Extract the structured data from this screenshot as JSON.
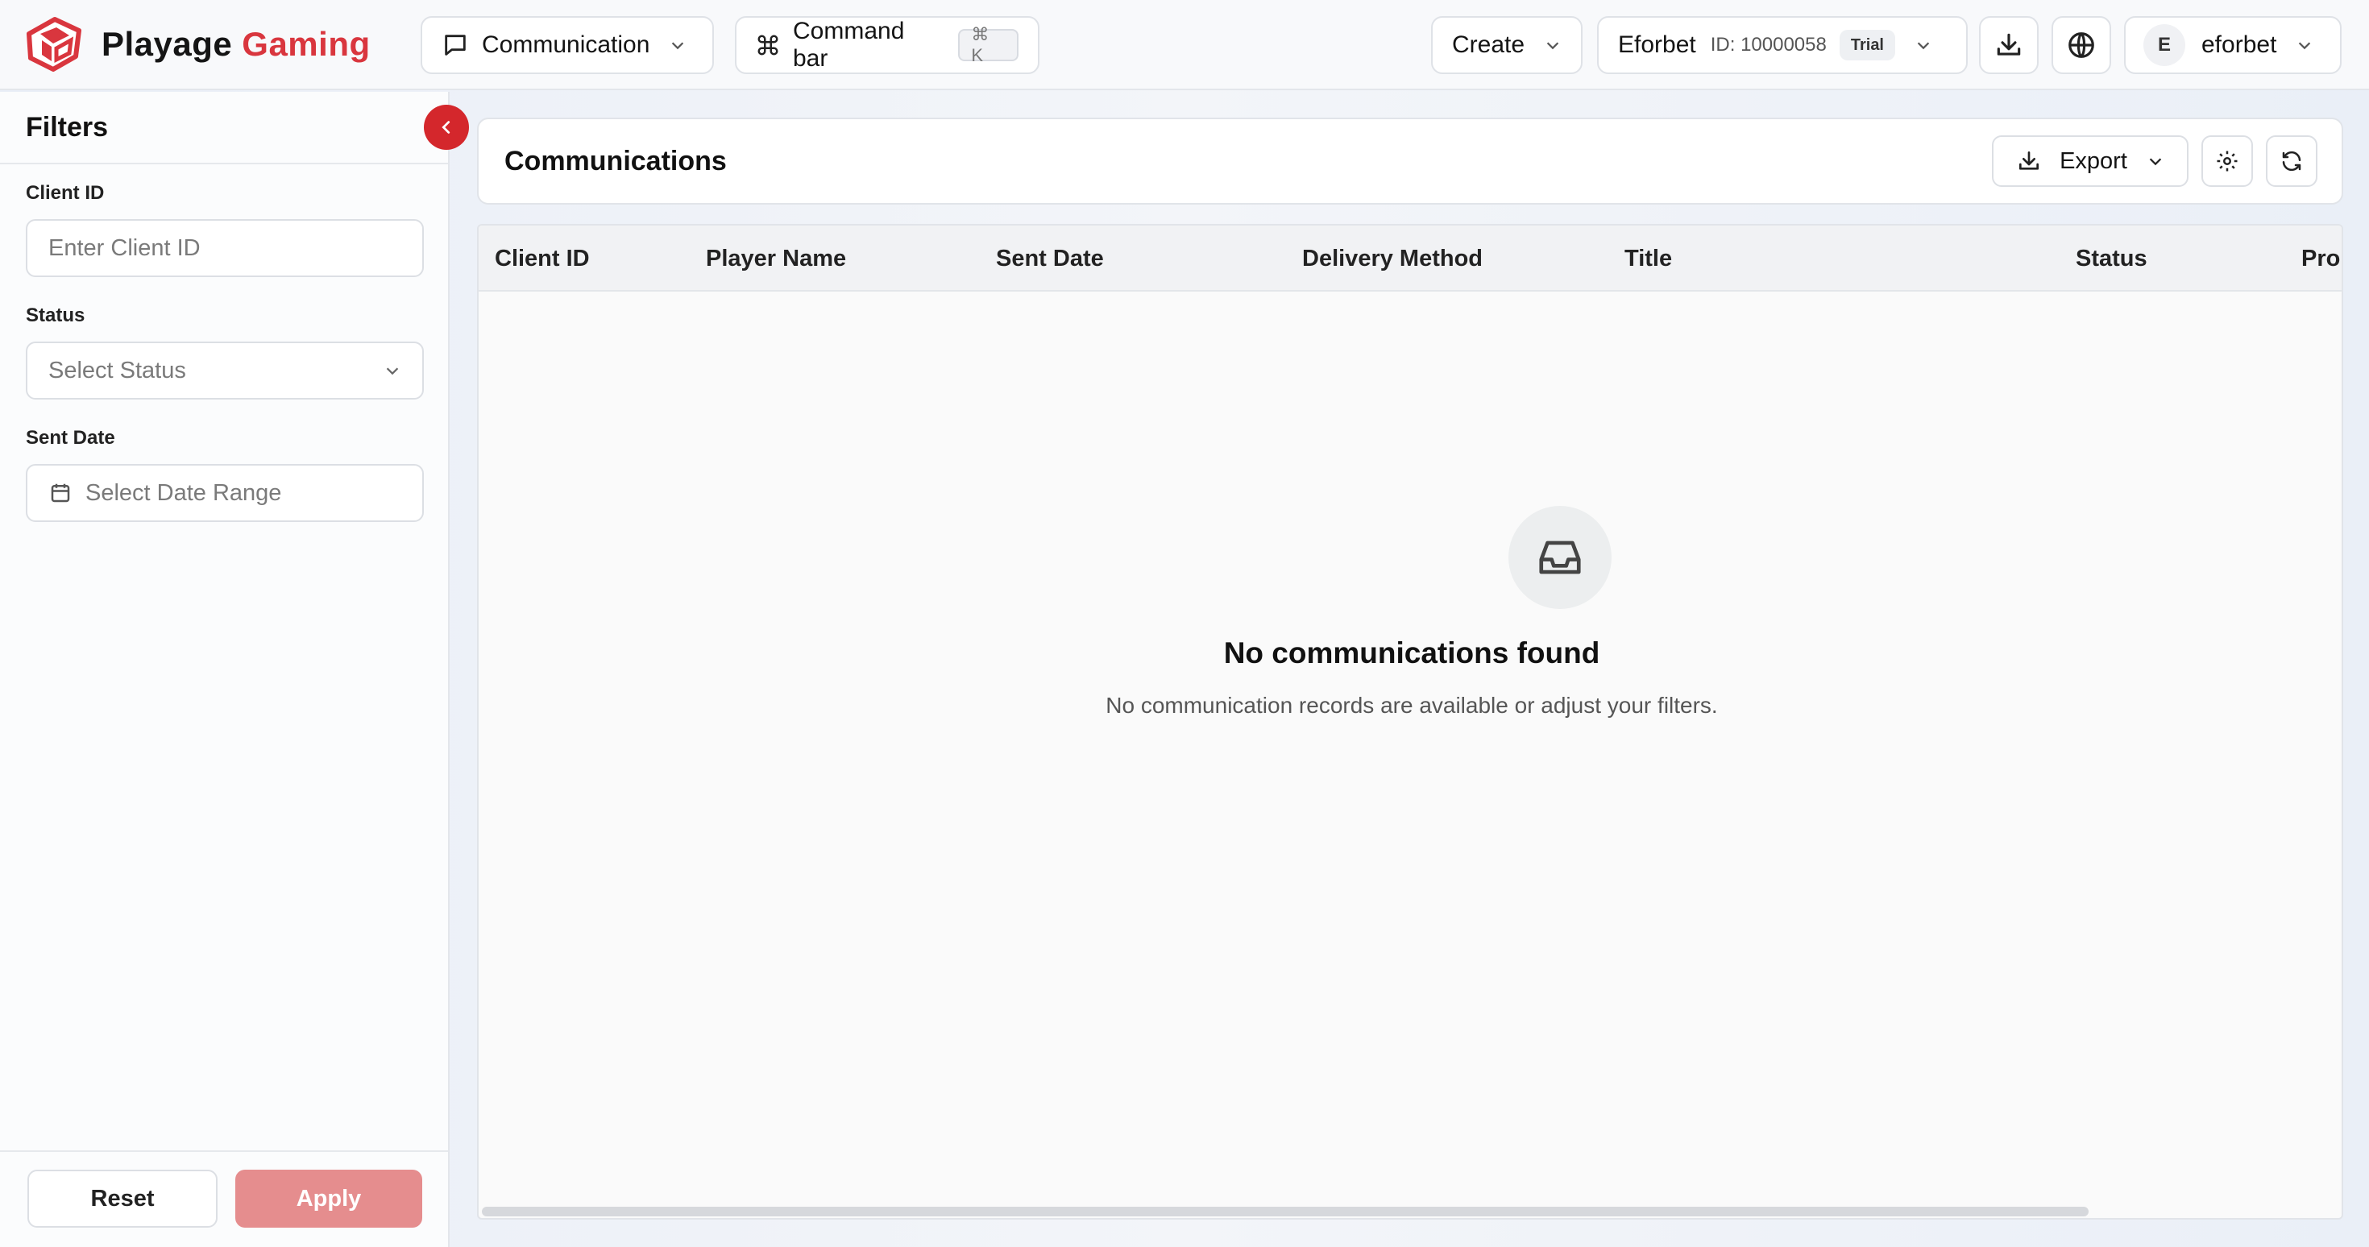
{
  "header": {
    "brand_first": "Playage",
    "brand_second": "Gaming",
    "module_selector": "Communication",
    "command_bar": "Command bar",
    "command_shortcut": "⌘ K",
    "create": "Create",
    "account_name": "Eforbet",
    "account_id": "ID: 10000058",
    "account_badge": "Trial",
    "user_initial": "E",
    "user_name": "eforbet"
  },
  "filters": {
    "title": "Filters",
    "client_id_label": "Client ID",
    "client_id_placeholder": "Enter Client ID",
    "status_label": "Status",
    "status_placeholder": "Select Status",
    "sent_date_label": "Sent Date",
    "sent_date_placeholder": "Select Date Range",
    "reset": "Reset",
    "apply": "Apply"
  },
  "main": {
    "title": "Communications",
    "export": "Export",
    "columns": [
      "Client ID",
      "Player Name",
      "Sent Date",
      "Delivery Method",
      "Title",
      "Status",
      "Pro"
    ],
    "empty_title": "No communications found",
    "empty_subtitle": "No communication records are available or adjust your filters."
  },
  "colors": {
    "accent": "#d9363e",
    "apply_disabled": "#e58d8e",
    "collapse_button": "#d4272c"
  }
}
